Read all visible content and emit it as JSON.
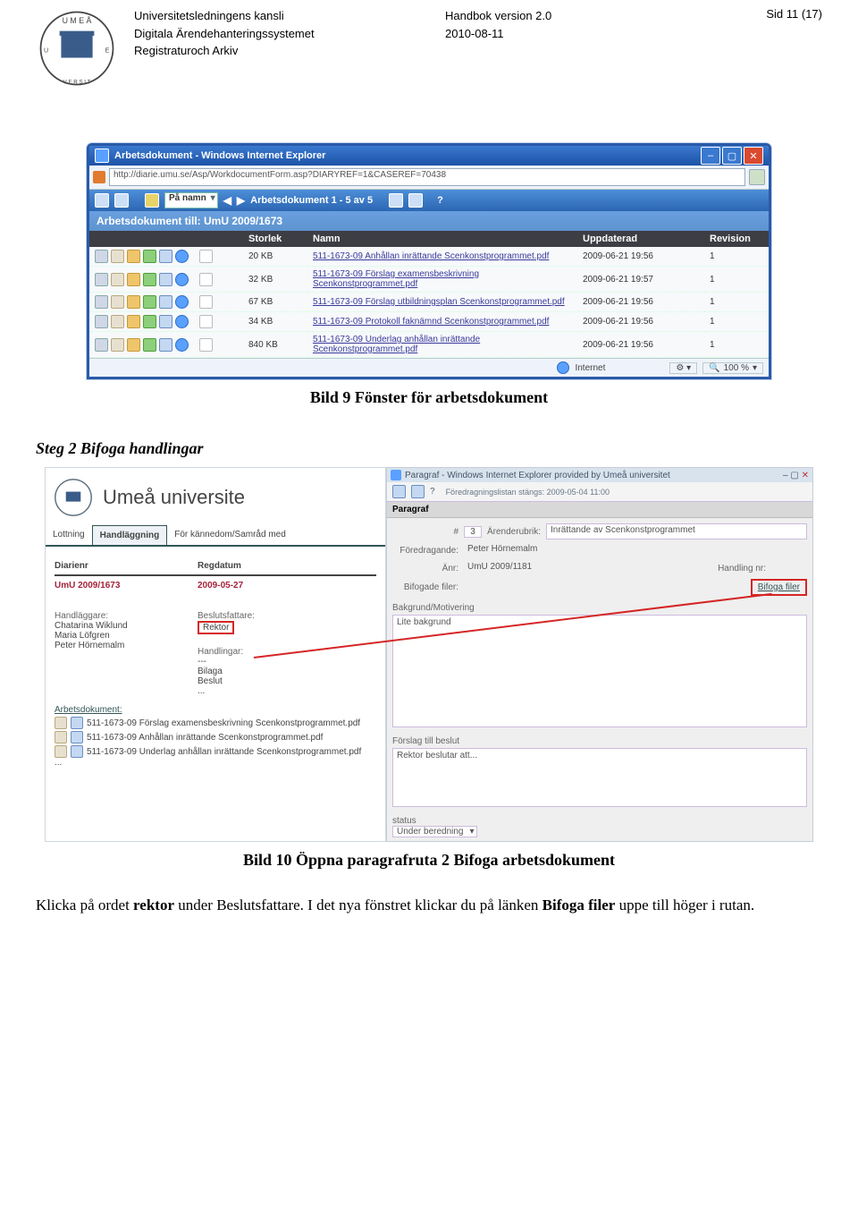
{
  "header": {
    "org1": "Universitetsledningens kansli",
    "org2": "Digitala Ärendehanteringssystemet",
    "org3": "Registraturoch Arkiv",
    "title": "Handbok version 2.0",
    "date": "2010-08-11",
    "page": "Sid 11 (17)"
  },
  "fig1": {
    "windowTitle": "Arbetsdokument - Windows Internet Explorer",
    "url": "http://diarie.umu.se/Asp/WorkdocumentForm.asp?DIARYREF=1&CASEREF=70438",
    "sortLabel": "På namn",
    "pager": "Arbetsdokument 1 - 5 av 5",
    "subtitle": "Arbetsdokument till: UmU 2009/1673",
    "cols": {
      "c1": "Storlek",
      "c2": "Namn",
      "c3": "Uppdaterad",
      "c4": "Revision"
    },
    "rows": [
      {
        "size": "20 KB",
        "name": "511-1673-09 Anhållan inrättande Scenkonstprogrammet.pdf",
        "upd": "2009-06-21 19:56",
        "rev": "1"
      },
      {
        "size": "32 KB",
        "name": "511-1673-09 Förslag examensbeskrivning Scenkonstprogrammet.pdf",
        "upd": "2009-06-21 19:57",
        "rev": "1"
      },
      {
        "size": "67 KB",
        "name": "511-1673-09 Förslag utbildningsplan Scenkonstprogrammet.pdf",
        "upd": "2009-06-21 19:56",
        "rev": "1"
      },
      {
        "size": "34 KB",
        "name": "511-1673-09 Protokoll faknämnd Scenkonstprogrammet.pdf",
        "upd": "2009-06-21 19:56",
        "rev": "1"
      },
      {
        "size": "840 KB",
        "name": "511-1673-09 Underlag anhållan inrättande Scenkonstprogrammet.pdf",
        "upd": "2009-06-21 19:56",
        "rev": "1"
      }
    ],
    "status": {
      "zone": "Internet",
      "zoom": "100 %"
    },
    "caption": "Bild 9 Fönster för arbetsdokument"
  },
  "step2": "Steg 2 Bifoga handlingar",
  "fig2": {
    "brand": "Umeå universite",
    "tabs": [
      "Lottning",
      "Handläggning",
      "För kännedom/Samråd med"
    ],
    "activeTab": 1,
    "leftHeaders": {
      "d": "Diarienr",
      "r": "Regdatum"
    },
    "leftVals": {
      "dnr": "UmU 2009/1673",
      "reg": "2009-05-27"
    },
    "handlaggareLabel": "Handläggare:",
    "handlaggare": [
      "Chatarina Wiklund",
      "Maria Löfgren",
      "Peter Hörnemalm"
    ],
    "beslutsLabel": "Beslutsfattare:",
    "besluts": "Rektor",
    "handlingarLabel": "Handlingar:",
    "handlingar": [
      "---",
      "Bilaga",
      "Beslut",
      "..."
    ],
    "arbLabel": "Arbetsdokument:",
    "attachments": [
      "511-1673-09 Förslag examensbeskrivning Scenkonstprogrammet.pdf",
      "511-1673-09 Anhållan inrättande Scenkonstprogrammet.pdf",
      "511-1673-09 Underlag anhållan inrättande Scenkonstprogrammet.pdf"
    ],
    "rightTitle": "Paragraf - Windows Internet Explorer provided by Umeå universitet",
    "rightInfo": "Föredragningslistan stängs: 2009-05-04 11:00",
    "paragraf": "Paragraf",
    "rform": {
      "num": "3",
      "arub": "Ärenderubrik:",
      "arubVal": "Inrättande av Scenkonstprogrammet",
      "fored": "Föredragande:",
      "foredVal": "Peter Hörnemalm",
      "anr": "Änr:",
      "anrVal": "UmU 2009/1181",
      "hnr": "Handling nr:",
      "bif": "Bifogade filer:",
      "bifoga": "Bifoga filer",
      "bak": "Bakgrund/Motivering",
      "bakVal": "Lite bakgrund",
      "fors": "Förslag till beslut",
      "forsVal": "Rektor beslutar att...",
      "status": "status",
      "statusVal": "Under beredning"
    },
    "caption": "Bild 10 Öppna paragrafruta 2 Bifoga arbetsdokument"
  },
  "body": {
    "p1a": "Klicka på ordet ",
    "p1b": "rektor",
    "p1c": " under Beslutsfattare. I det nya fönstret klickar du på länken ",
    "p1d": "Bifoga filer",
    "p1e": " uppe till höger i rutan."
  }
}
